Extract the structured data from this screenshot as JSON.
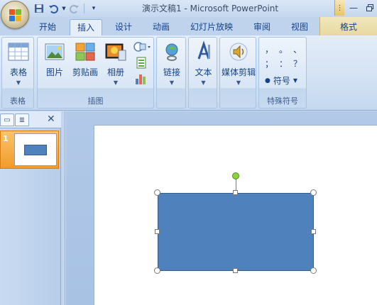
{
  "window": {
    "title": "演示文稿1 - Microsoft PowerPoint"
  },
  "quick_access": {
    "icons": [
      "save-icon",
      "undo-icon",
      "redo-icon",
      "customize-icon"
    ]
  },
  "tabs": [
    {
      "label": "开始",
      "active": false
    },
    {
      "label": "插入",
      "active": true
    },
    {
      "label": "设计",
      "active": false
    },
    {
      "label": "动画",
      "active": false
    },
    {
      "label": "幻灯片放映",
      "active": false
    },
    {
      "label": "审阅",
      "active": false
    },
    {
      "label": "视图",
      "active": false
    },
    {
      "label": "格式",
      "active": false,
      "contextual": true
    }
  ],
  "ribbon": {
    "groups": {
      "table": {
        "label": "表格",
        "buttons": {
          "table": "表格"
        }
      },
      "illustrations": {
        "label": "插图",
        "buttons": {
          "picture": "图片",
          "clipart": "剪贴画",
          "album": "相册"
        }
      },
      "links": {
        "label": "",
        "buttons": {
          "link": "链接"
        }
      },
      "text": {
        "label": "",
        "buttons": {
          "text": "文本"
        }
      },
      "media": {
        "label": "",
        "buttons": {
          "media": "媒体剪辑"
        }
      },
      "symbols": {
        "label": "特殊符号",
        "chars": [
          "，",
          "。",
          "、",
          "；",
          "：",
          "？"
        ],
        "symbol_button": "符号"
      }
    }
  },
  "slides_pane": {
    "slides": [
      {
        "number": "1",
        "selected": true
      }
    ]
  },
  "colors": {
    "shape_fill": "#4f81bd",
    "shape_border": "#385d8a",
    "selected_slide": "#f29a2b",
    "rotation_handle": "#8fd13b"
  }
}
